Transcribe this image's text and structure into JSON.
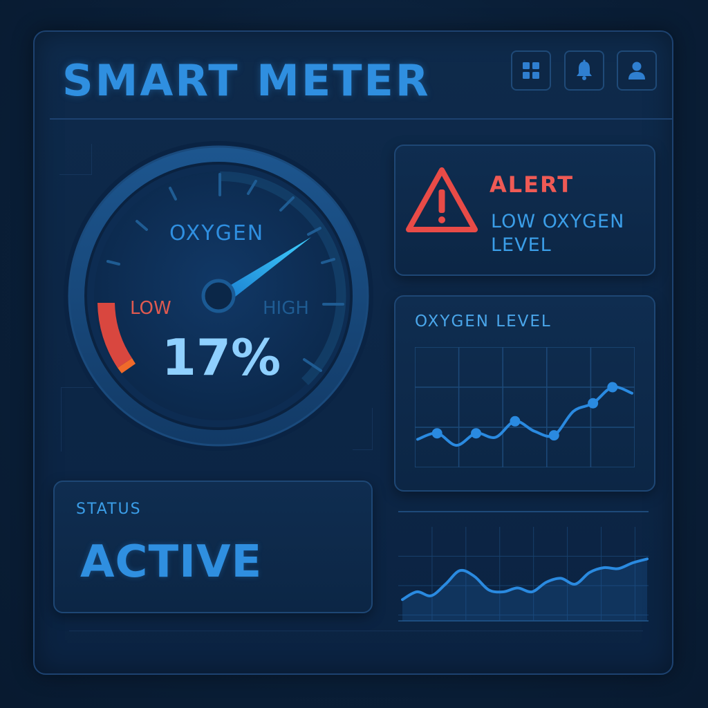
{
  "header": {
    "title": "SMART METER",
    "icons": [
      "grid-icon",
      "bell-icon",
      "user-icon"
    ]
  },
  "gauge": {
    "label": "OXYGEN",
    "low_label": "LOW",
    "high_label": "HIGH",
    "value_text": "17%",
    "value_fraction": 0.17
  },
  "alert": {
    "title": "ALERT",
    "message": "LOW OXYGEN LEVEL",
    "icon": "warning-icon"
  },
  "oxygen_chart": {
    "title": "OXYGEN LEVEL"
  },
  "status": {
    "label": "STATUS",
    "value": "ACTIVE"
  },
  "colors": {
    "accent": "#2f8fe0",
    "alert": "#ef5a55",
    "background": "#0b2342"
  },
  "chart_data": [
    {
      "type": "line",
      "title": "OXYGEN LEVEL",
      "x": [
        0,
        1,
        2,
        3,
        4,
        5,
        6,
        7,
        8,
        9,
        10,
        11
      ],
      "values": [
        14,
        17,
        11,
        17,
        15,
        23,
        18,
        16,
        28,
        32,
        40,
        37
      ],
      "markers": [
        1,
        3,
        5,
        7,
        9,
        10
      ],
      "ylim": [
        0,
        60
      ],
      "grid": true
    },
    {
      "type": "area",
      "x": [
        0,
        1,
        2,
        3,
        4,
        5,
        6,
        7,
        8,
        9,
        10,
        11,
        12,
        13,
        14,
        15,
        16,
        17
      ],
      "values": [
        22,
        30,
        26,
        38,
        52,
        46,
        32,
        30,
        34,
        30,
        40,
        44,
        38,
        50,
        55,
        54,
        60,
        64
      ],
      "ylim": [
        0,
        100
      ],
      "grid": true
    }
  ]
}
